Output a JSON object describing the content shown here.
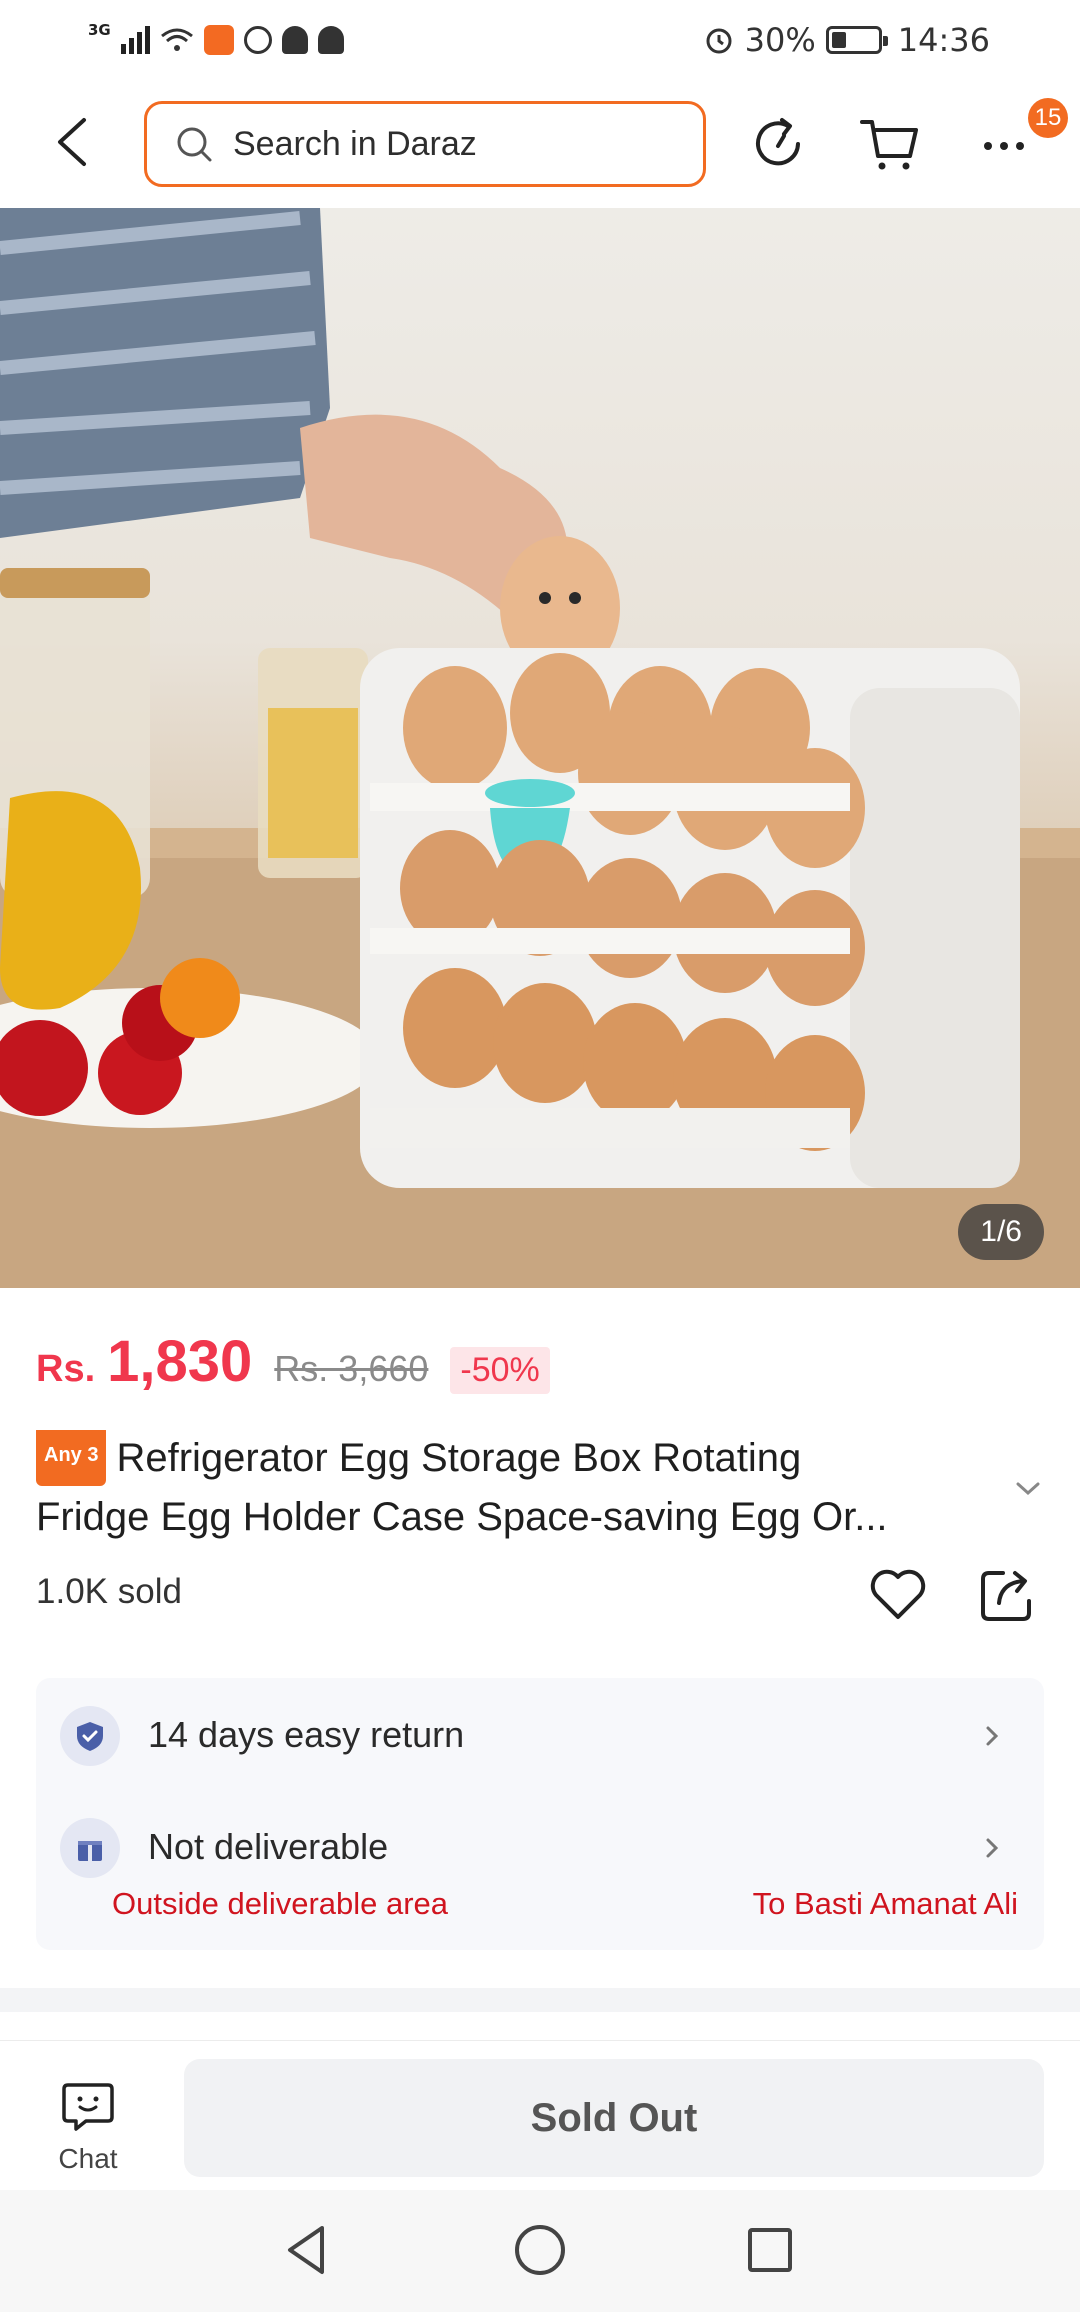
{
  "status_bar": {
    "network": "3G",
    "battery": "30%",
    "time": "14:36"
  },
  "header": {
    "search_placeholder": "Search in Daraz",
    "cart_badge": "15"
  },
  "gallery": {
    "counter": "1/6"
  },
  "product": {
    "currency": "Rs.",
    "price": "1,830",
    "original_price": "Rs. 3,660",
    "discount": "-50%",
    "promo_tag": "Any 3",
    "title": "Refrigerator Egg Storage Box Rotating Fridge Egg Holder Case Space-saving Egg Or...",
    "title_line1": "Refrigerator Egg Storage Box Rotating",
    "title_line2": "Fridge Egg Holder Case Space-saving Egg Or...",
    "sold": "1.0K sold"
  },
  "service": {
    "return_label": "14 days easy return",
    "delivery_label": "Not deliverable",
    "delivery_note": "Outside deliverable area",
    "delivery_location": "To Basti Amanat Ali"
  },
  "bottom_bar": {
    "chat_label": "Chat",
    "sold_out_label": "Sold Out"
  },
  "colors": {
    "accent": "#f26b21",
    "price": "#f0374d",
    "warning": "#d0141f"
  }
}
